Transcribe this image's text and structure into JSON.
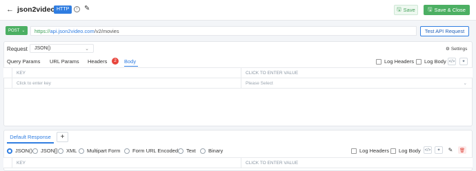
{
  "header": {
    "back_icon": "arrow-left-icon",
    "title": "json2video",
    "badge": "HTTP",
    "info_icon": "i",
    "edit_icon": "pencil-icon",
    "save_label": "Save",
    "save_close_label": "Save & Close"
  },
  "url_bar": {
    "method": "POST",
    "url_scheme": "https://",
    "url_domain": "api.json2video.com",
    "url_path": "/v2/movies",
    "test_label": "Test API Request"
  },
  "request": {
    "label": "Request",
    "type_value": "JSON()",
    "settings_label": "Settings",
    "tabs": [
      {
        "label": "Query Params"
      },
      {
        "label": "URL Params"
      },
      {
        "label": "Headers",
        "badge": "2"
      },
      {
        "label": "Body",
        "active": true
      }
    ],
    "log_headers_label": "Log Headers",
    "log_body_label": "Log Body",
    "table": {
      "col_key": "KEY",
      "col_value": "CLICK TO ENTER VALUE",
      "key_placeholder": "Click to enter key",
      "value_placeholder": "Please Select"
    }
  },
  "response": {
    "tab_label": "Default Response",
    "add_label": "+",
    "formats": [
      {
        "label": "JSON()",
        "selected": true
      },
      {
        "label": "JSON[]"
      },
      {
        "label": "XML"
      },
      {
        "label": "Multipart Form"
      },
      {
        "label": "Form URL Encoded"
      },
      {
        "label": "Text"
      },
      {
        "label": "Binary"
      }
    ],
    "log_headers_label": "Log Headers",
    "log_body_label": "Log Body",
    "table": {
      "col_key": "KEY",
      "col_value": "CLICK TO ENTER VALUE"
    }
  },
  "colors": {
    "primary": "#2f7de1",
    "success": "#4caf63",
    "danger": "#e8453c"
  }
}
